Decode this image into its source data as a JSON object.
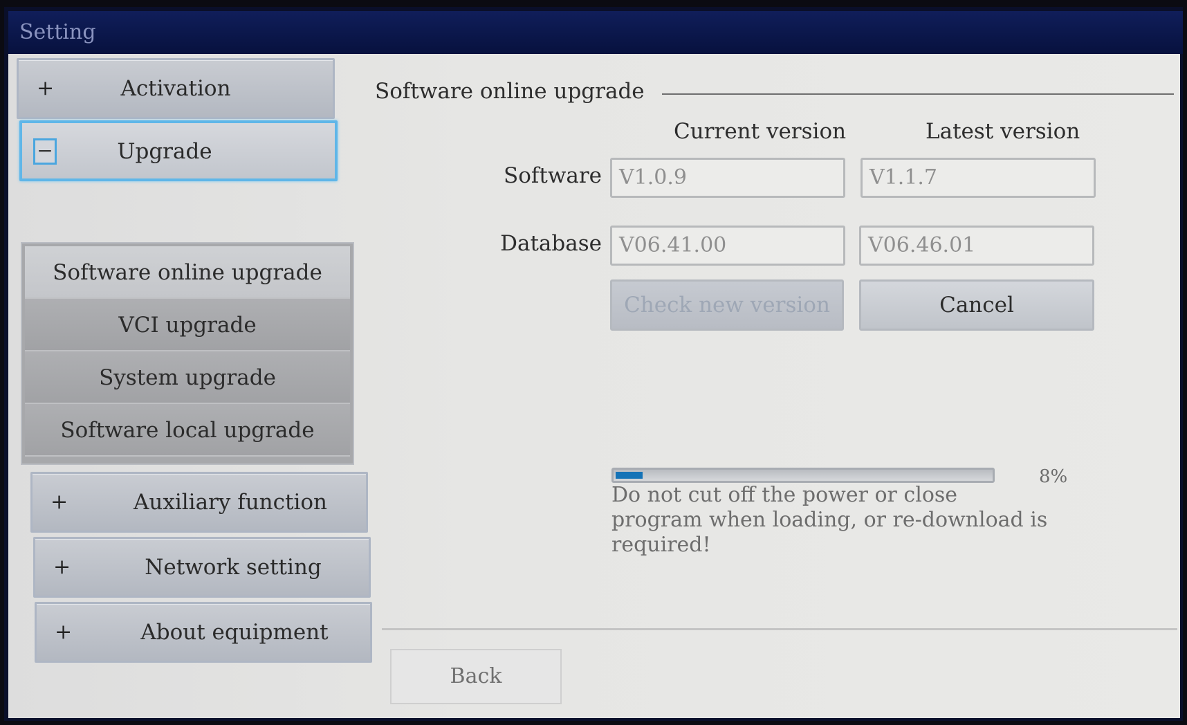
{
  "window": {
    "title": "Setting"
  },
  "nav": {
    "activation": {
      "symbol": "+",
      "label": "Activation"
    },
    "upgrade": {
      "symbol": "−",
      "label": "Upgrade"
    },
    "upgrade_items": [
      "Software online upgrade",
      "VCI upgrade",
      "System upgrade",
      "Software local upgrade"
    ],
    "auxiliary": {
      "symbol": "+",
      "label": "Auxiliary function"
    },
    "network": {
      "symbol": "+",
      "label": "Network setting"
    },
    "about": {
      "symbol": "+",
      "label": "About equipment"
    }
  },
  "panel": {
    "section_title": "Software online upgrade",
    "col_current": "Current version",
    "col_latest": "Latest version",
    "software_label": "Software",
    "software_current": "V1.0.9",
    "software_latest": "V1.1.7",
    "database_label": "Database",
    "database_current": "V06.41.00",
    "database_latest": "V06.46.01",
    "check_button": "Check new version",
    "cancel_button": "Cancel",
    "progress_percent": 8,
    "progress_text": "8%",
    "warning": "Do not cut off the power or close program when loading, or re-download is required!",
    "back_button": "Back"
  },
  "colors": {
    "titlebar": "#07113e",
    "accent_border": "#5fb6e8",
    "progress_fill": "#1573b7"
  }
}
